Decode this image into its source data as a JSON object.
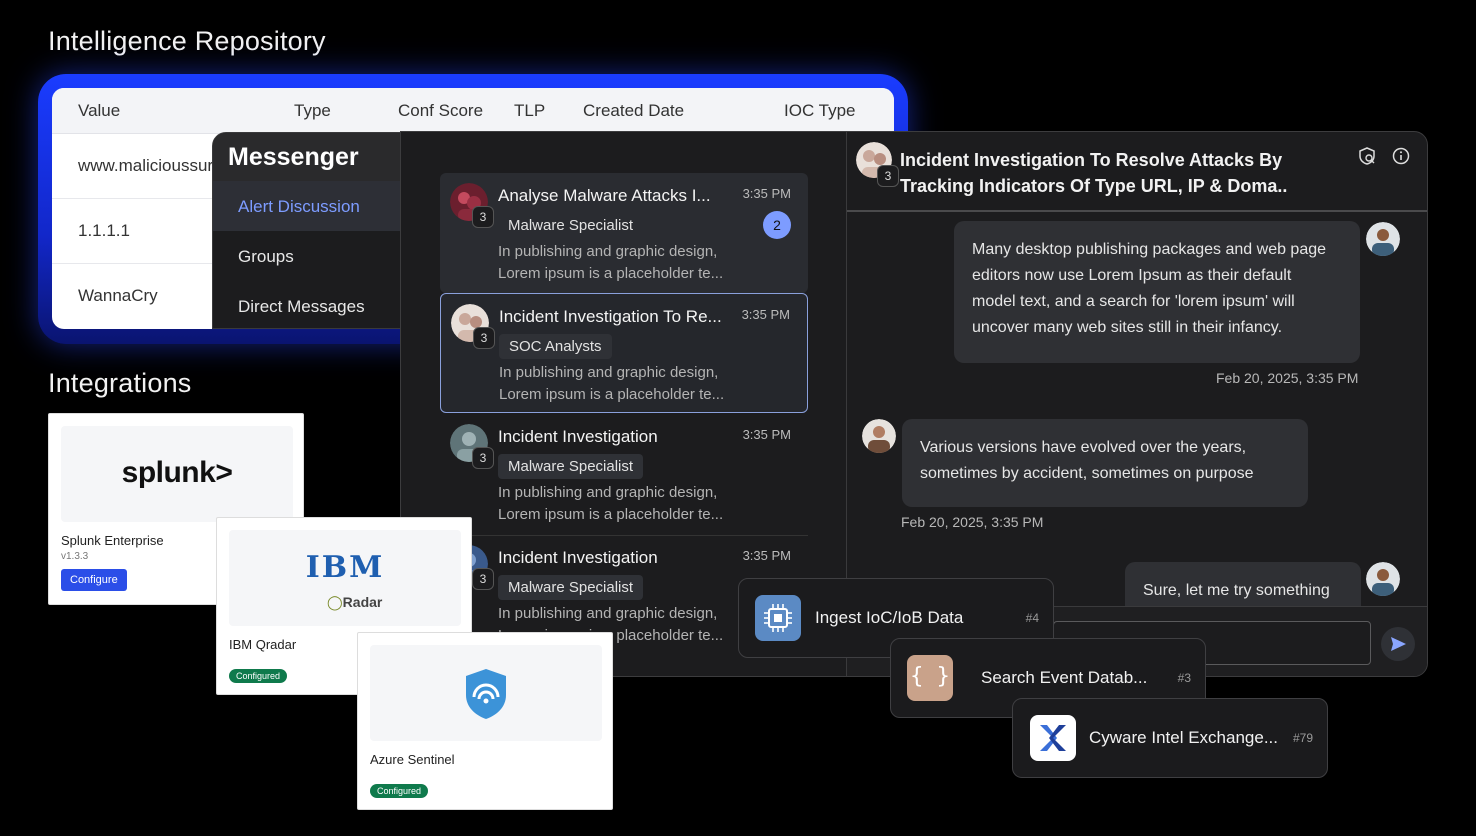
{
  "repository": {
    "title": "Intelligence Repository",
    "columns": [
      "Value",
      "Type",
      "Conf Score",
      "TLP",
      "Created Date",
      "IOC Type"
    ],
    "rows": [
      "www.malicioussur",
      "1.1.1.1",
      "WannaCry"
    ]
  },
  "messenger": {
    "title": "Messenger",
    "items": [
      "Alert Discussion",
      "Groups",
      "Direct Messages"
    ]
  },
  "conversations": [
    {
      "title": "Analyse Malware Attacks I...",
      "time": "3:35 PM",
      "tag": "Malware Specialist",
      "preview1": "In publishing and graphic design,",
      "preview2": "Lorem ipsum is a placeholder te...",
      "count": "3",
      "unread": "2"
    },
    {
      "title": "Incident Investigation To Re...",
      "time": "3:35 PM",
      "tag": "SOC Analysts",
      "preview1": "In publishing and graphic design,",
      "preview2": "Lorem ipsum is a placeholder te...",
      "count": "3"
    },
    {
      "title": "Incident Investigation",
      "time": "3:35 PM",
      "tag": "Malware Specialist",
      "preview1": "In publishing and graphic design,",
      "preview2": "Lorem ipsum is a placeholder te...",
      "count": "3"
    },
    {
      "title": "Incident Investigation",
      "time": "3:35 PM",
      "tag": "Malware Specialist",
      "preview1": "In publishing and graphic design,",
      "preview2": "Lorem ipsum is a placeholder te...",
      "count": "3"
    }
  ],
  "thread": {
    "title_line1": "Incident Investigation To Resolve Attacks By",
    "title_line2": "Tracking Indicators Of Type URL, IP & Doma..",
    "count": "3",
    "messages": [
      {
        "lines": [
          "Many desktop publishing packages and web page",
          "editors now use Lorem Ipsum as their default",
          "model text, and a search for 'lorem ipsum' will",
          "uncover many web sites still in their infancy."
        ],
        "time": "Feb 20, 2025, 3:35 PM"
      },
      {
        "lines": [
          "Various versions have evolved over the years,",
          "sometimes by accident, sometimes on purpose"
        ],
        "time": "Feb 20, 2025, 3:35 PM"
      },
      {
        "lines": [
          "Sure, let me try something"
        ]
      }
    ]
  },
  "integrations": {
    "title": "Integrations",
    "cards": [
      {
        "name": "Splunk Enterprise",
        "version": "v1.3.3",
        "action": "Configure",
        "logo": "splunk>"
      },
      {
        "name": "IBM Qradar",
        "status": "Configured",
        "logo_top": "IBM",
        "logo_bottom": "Radar"
      },
      {
        "name": "Azure Sentinel",
        "status": "Configured"
      }
    ]
  },
  "playbook_steps": [
    {
      "label": "Ingest IoC/IoB Data",
      "num": "#4",
      "icon": "chip-icon"
    },
    {
      "label": "Search Event Datab...",
      "num": "#3",
      "icon": "braces-icon"
    },
    {
      "label": "Cyware Intel Exchange...",
      "num": "#79",
      "icon": "cyware-x-icon"
    }
  ],
  "colors": {
    "accent_blue": "#7d9cff",
    "glow_blue": "#1a3cff",
    "configured_green": "#0f7a4c",
    "configure_button": "#2b4ee8"
  }
}
